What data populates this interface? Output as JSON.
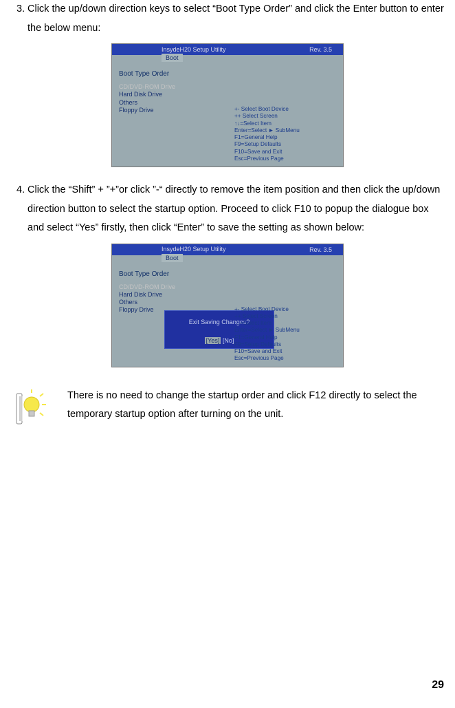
{
  "steps": {
    "s3_num": "3.",
    "s3_text": "Click the up/down direction keys to select “Boot Type Order” and click the Enter button to enter the below menu:",
    "s4_num": "4.",
    "s4_text": "Click the “Shift” + ”+”or click ”-“ directly to remove the item position and then click the up/down direction button to select the startup option. Proceed to click F10 to popup the dialogue box and select “Yes” firstly, then click “Enter” to save the setting as shown below:"
  },
  "bios1": {
    "topbar": "InsydeH20 Setup Utility",
    "rev": "Rev. 3.5",
    "tab": "Boot",
    "title": "Boot Type Order",
    "items": [
      "CD/DVD-ROM Drive",
      "Hard Disk Drive",
      "Others",
      "Floppy Drive"
    ],
    "help": [
      "+-    Select Boot Device",
      "++    Select Screen",
      "↑↓=Select Item",
      "Enter=Select ► SubMenu",
      "F1=General Help",
      "F9=Setup Defaults",
      "F10=Save and Exit",
      "Esc=Previous Page"
    ]
  },
  "bios2": {
    "topbar": "InsydeH20 Setup Utility",
    "rev": "Rev. 3.5",
    "tab": "Boot",
    "title": "Boot Type Order",
    "items": [
      "CD/DVD-ROM Drive",
      "Hard Disk Drive",
      "Others",
      "Floppy Drive"
    ],
    "dialog_msg": "Exit Saving Changes?",
    "dialog_yes": "[Yes]",
    "dialog_no": "[No]",
    "help": [
      "+-    Select Boot Device",
      "++    Select Screen",
      "↑↓=Select Item",
      "Enter=Select ► SubMenu",
      "F1=General Help",
      "F9=Setup Defaults",
      "F10=Save and Exit",
      "Esc=Previous Page"
    ]
  },
  "tip": "There is no need to change the startup order and click F12 directly to select the temporary startup option after turning on the unit.",
  "page_number": "29"
}
